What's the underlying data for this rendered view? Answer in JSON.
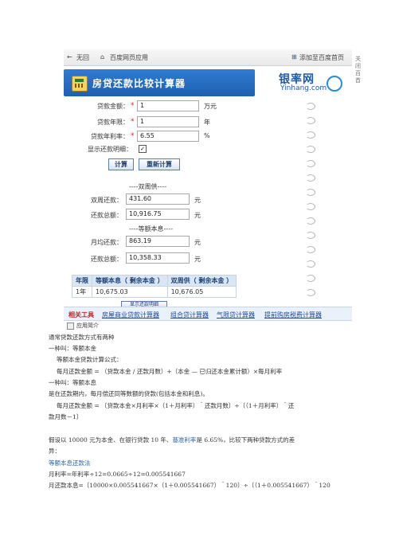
{
  "toolbar": {
    "back": "无回",
    "home": "百度网页应用",
    "add": "添加至百度首页"
  },
  "side_text": "关闭百首",
  "banner": {
    "title": "房贷还款比较计算器",
    "logo_cn": "银率网",
    "logo_en": "Yinhang.com"
  },
  "form": {
    "amount_label": "贷款金额：",
    "amount_value": "1",
    "amount_unit": "万元",
    "years_label": "贷款年限：",
    "years_value": "1",
    "years_unit": "年",
    "rate_label": "贷款年利率：",
    "rate_value": "6.55",
    "rate_unit": "%",
    "show_detail_label": "显示还款明细：",
    "show_detail_checked": "✓",
    "required_mark": "*",
    "calc_button": "计算",
    "reset_button": "重新计算"
  },
  "results": {
    "equal_payment_title": "----双周供----",
    "equal_payment_amount_label": "双周还款：",
    "equal_payment_amount": "431.60",
    "equal_payment_total_label": "还款总额：",
    "equal_payment_total": "10,916.75",
    "equal_principal_title": "----等额本息----",
    "monthly_label": "月均还款：",
    "monthly_value": "863.19",
    "principal_total_label": "还款总额：",
    "principal_total": "10,358.33",
    "unit": "元"
  },
  "table": {
    "headers": [
      "年限",
      "等额本息（ 剩余本金 ）",
      "双周供（ 剩余本金 ）"
    ],
    "rows": [
      [
        "1年",
        "10,675.03",
        "10,676.05"
      ]
    ],
    "hidden_button": "显示还款明细"
  },
  "related": {
    "title": "相关工具",
    "links": [
      "房屋商业贷款计算器",
      "组合贷计算器",
      "气限贷计算器",
      "提前购房税费计算器"
    ]
  },
  "intro": "应用简介",
  "article": {
    "l1": "通常贷款还款方式有两种",
    "l2": "一种叫：等额本金",
    "l3": "等额本金贷款计算公式：",
    "l4": "每月还款金额 = （贷款本金 / 还款月数）+（本金 — 已归还本金累计额）×每月利率",
    "l5": "一种叫：等额本息",
    "l6": "是在还款期内，每月偿还同等数额的贷款(包括本金和利息)。",
    "l7": "每月还款金额 = 〔贷款本金×月利率×（1＋月利率）＾还款月数〕÷〔（1＋月利率）＾还",
    "l8": "款月数－1〕",
    "l9a": "假设以 10000 元为本金、在银行贷款 10 年、",
    "l9b": "基准利率",
    "l9c": "是 6.65%，比较下两种贷款方式的差",
    "l10": "异：",
    "l11": "等额本息还款法",
    "l12": "月利率=年利率÷12=0.0665÷12=0.005541667",
    "l13": "月还款本息=〔10000×0.005541667×（1＋0.005541667）＾120〕÷〔（1＋0.005541667）＾120"
  },
  "colors": {
    "banner": "#1e5fb1",
    "accent_red": "#c02020",
    "link_blue": "#1d4c9c"
  }
}
